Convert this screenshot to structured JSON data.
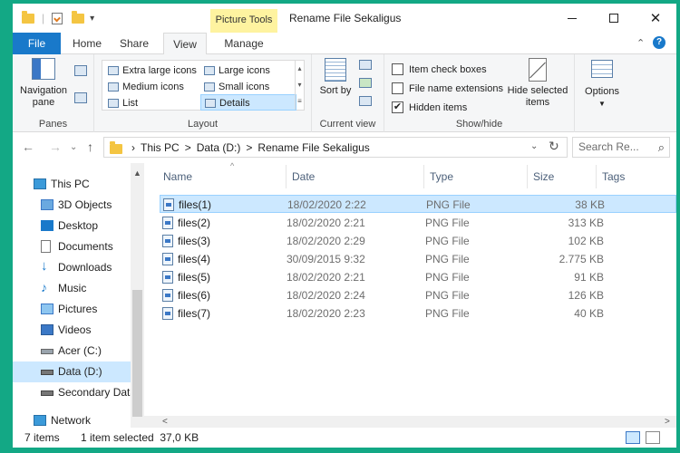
{
  "window": {
    "title": "Rename File Sekaligus",
    "context_tab": "Picture Tools"
  },
  "tabs": [
    {
      "label": "File"
    },
    {
      "label": "Home"
    },
    {
      "label": "Share"
    },
    {
      "label": "View"
    },
    {
      "label": "Manage"
    }
  ],
  "ribbon": {
    "panes": {
      "nav_label": "Navigation pane",
      "group": "Panes"
    },
    "layout": {
      "group": "Layout",
      "options": [
        "Extra large icons",
        "Large icons",
        "Medium icons",
        "Small icons",
        "List",
        "Details"
      ],
      "selected": "Details"
    },
    "current_view": {
      "sort_label": "Sort by",
      "group": "Current view"
    },
    "show_hide": {
      "group": "Show/hide",
      "item_check_boxes": "Item check boxes",
      "file_name_extensions": "File name extensions",
      "hidden_items": "Hidden items",
      "hide_selected": "Hide selected items"
    },
    "options_label": "Options"
  },
  "address": {
    "crumbs": [
      "This PC",
      ">",
      "Data (D:)",
      ">",
      "Rename File Sekaligus"
    ],
    "search_placeholder": "Search Re..."
  },
  "sidebar": [
    {
      "label": "This PC",
      "icon": "monitor-icon"
    },
    {
      "label": "3D Objects",
      "icon": "3d-objects-icon"
    },
    {
      "label": "Desktop",
      "icon": "desktop-icon"
    },
    {
      "label": "Documents",
      "icon": "documents-icon"
    },
    {
      "label": "Downloads",
      "icon": "download-arrow-icon"
    },
    {
      "label": "Music",
      "icon": "music-note-icon"
    },
    {
      "label": "Pictures",
      "icon": "pictures-icon"
    },
    {
      "label": "Videos",
      "icon": "videos-icon"
    },
    {
      "label": "Acer (C:)",
      "icon": "drive-icon"
    },
    {
      "label": "Data (D:)",
      "icon": "drive-icon",
      "selected": true
    },
    {
      "label": "Secondary Data",
      "icon": "drive-icon"
    },
    {
      "label": "Network",
      "icon": "network-icon"
    }
  ],
  "columns": {
    "name": "Name",
    "date": "Date",
    "type": "Type",
    "size": "Size",
    "tags": "Tags"
  },
  "files": [
    {
      "name": "files(1)",
      "date": "18/02/2020 2:22",
      "type": "PNG File",
      "size": "38 KB",
      "selected": true
    },
    {
      "name": "files(2)",
      "date": "18/02/2020 2:21",
      "type": "PNG File",
      "size": "313 KB"
    },
    {
      "name": "files(3)",
      "date": "18/02/2020 2:29",
      "type": "PNG File",
      "size": "102 KB"
    },
    {
      "name": "files(4)",
      "date": "30/09/2015 9:32",
      "type": "PNG File",
      "size": "2.775 KB"
    },
    {
      "name": "files(5)",
      "date": "18/02/2020 2:21",
      "type": "PNG File",
      "size": "91 KB"
    },
    {
      "name": "files(6)",
      "date": "18/02/2020 2:24",
      "type": "PNG File",
      "size": "126 KB"
    },
    {
      "name": "files(7)",
      "date": "18/02/2020 2:23",
      "type": "PNG File",
      "size": "40 KB"
    }
  ],
  "status": {
    "count": "7 items",
    "selection": "1 item selected  37,0 KB"
  },
  "colors": {
    "accent": "#1979ca",
    "selection": "#cce8ff",
    "background": "#13a885"
  }
}
